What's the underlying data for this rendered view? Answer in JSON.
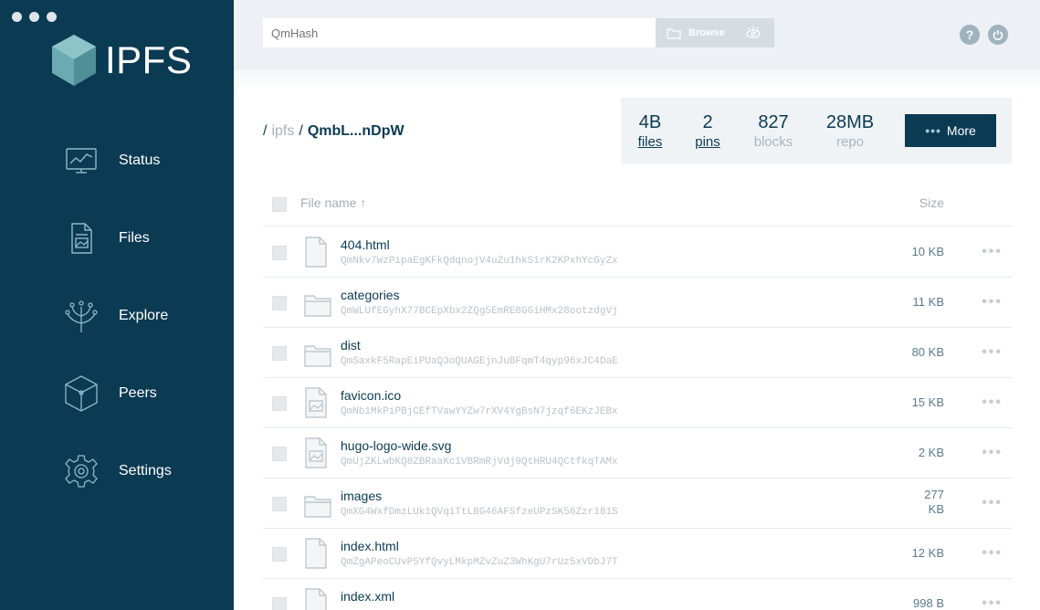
{
  "app": {
    "name": "IPFS"
  },
  "sidebar": {
    "items": [
      {
        "label": "Status",
        "icon": "status-monitor-icon"
      },
      {
        "label": "Files",
        "icon": "files-document-icon"
      },
      {
        "label": "Explore",
        "icon": "explore-tree-icon"
      },
      {
        "label": "Peers",
        "icon": "peers-cube-icon"
      },
      {
        "label": "Settings",
        "icon": "settings-gear-icon"
      }
    ]
  },
  "header": {
    "search_placeholder": "QmHash",
    "browse_label": "Browse"
  },
  "breadcrumb": {
    "root": "ipfs",
    "current": "QmbL...nDpW"
  },
  "stats": {
    "files": {
      "value": "4B",
      "label": "files"
    },
    "pins": {
      "value": "2",
      "label": "pins"
    },
    "blocks": {
      "value": "827",
      "label": "blocks"
    },
    "repo": {
      "value": "28MB",
      "label": "repo"
    },
    "more_label": "More"
  },
  "table": {
    "col_name": "File name ↑",
    "col_size": "Size",
    "rows": [
      {
        "name": "404.html",
        "hash": "QmNkv7WzPipaEgKFkQdqnojV4uZu1hkS1rK2KPxhYcGyZx",
        "size": "10 KB",
        "type": "file"
      },
      {
        "name": "categories",
        "hash": "QmWLUfEGyhX77BCEpXbx2ZQg5EmRE8GGiHMx28ootzdgVj",
        "size": "11 KB",
        "type": "folder"
      },
      {
        "name": "dist",
        "hash": "QmSaxkF5RapEiPUaQ3oQUAGEjnJuBFqmT4qyp96xJC4DaE",
        "size": "80 KB",
        "type": "folder"
      },
      {
        "name": "favicon.ico",
        "hash": "QmNb1MkPiPBjCEfTVawYYZw7rXV4YgBsN7jzqf6EKzJEBx",
        "size": "15 KB",
        "type": "image"
      },
      {
        "name": "hugo-logo-wide.svg",
        "hash": "QmUjZKLwbKQ8ZBRaaKc1VBRmRjVdj9QtHRU4QCtfkqTAMx",
        "size": "2 KB",
        "type": "image"
      },
      {
        "name": "images",
        "hash": "QmXG4WxfDmzLUk1QVqiTtLBG46AFSfzeUPzSK56Zzr181S",
        "size_line1": "277",
        "size_line2": "KB",
        "type": "folder"
      },
      {
        "name": "index.html",
        "hash": "QmZgAPeoCUvP5YfQvyLMkpMZvZuZ3WhKgU7rUz5xVDbJ7T",
        "size": "12 KB",
        "type": "file"
      },
      {
        "name": "index.xml",
        "hash": "",
        "size": "998 B",
        "type": "file"
      }
    ]
  },
  "colors": {
    "sidebar_bg": "#0b3a53",
    "accent": "#0b3a53",
    "header_bg": "#edf0f4"
  }
}
